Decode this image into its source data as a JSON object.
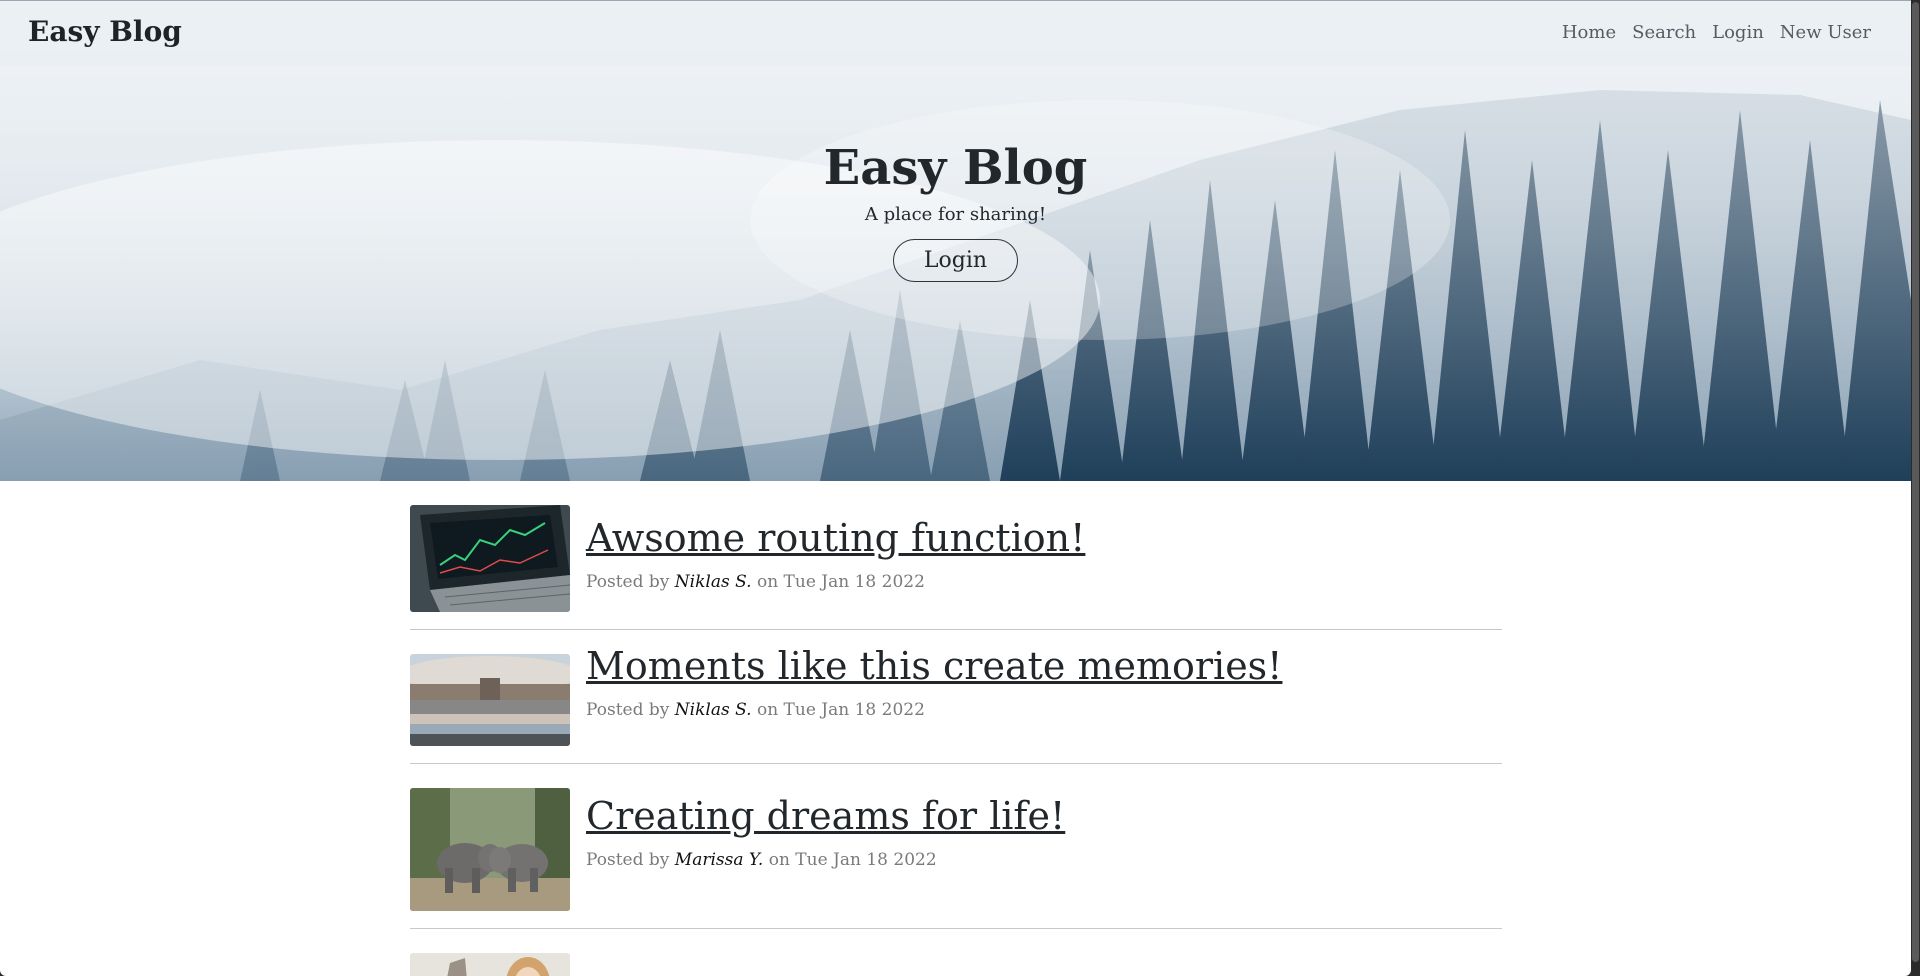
{
  "nav": {
    "brand": "Easy Blog",
    "links": [
      "Home",
      "Search",
      "Login",
      "New User"
    ]
  },
  "hero": {
    "title": "Easy Blog",
    "subtitle": "A place for sharing!",
    "button": "Login"
  },
  "posts": [
    {
      "title": "Awsome routing function!",
      "prefix": "Posted by",
      "author": "Niklas S.",
      "date": "on Tue Jan 18 2022",
      "image": "laptop-chart-image"
    },
    {
      "title": "Moments like this create memories!",
      "prefix": "Posted by",
      "author": "Niklas S.",
      "date": "on Tue Jan 18 2022",
      "image": "city-reflection-image"
    },
    {
      "title": "Creating dreams for life!",
      "prefix": "Posted by",
      "author": "Marissa Y.",
      "date": "on Tue Jan 18 2022",
      "image": "elephants-image"
    }
  ],
  "colors": {
    "text": "#22272b",
    "meta": "#7a7a7a",
    "divider": "#c8c8c8"
  }
}
